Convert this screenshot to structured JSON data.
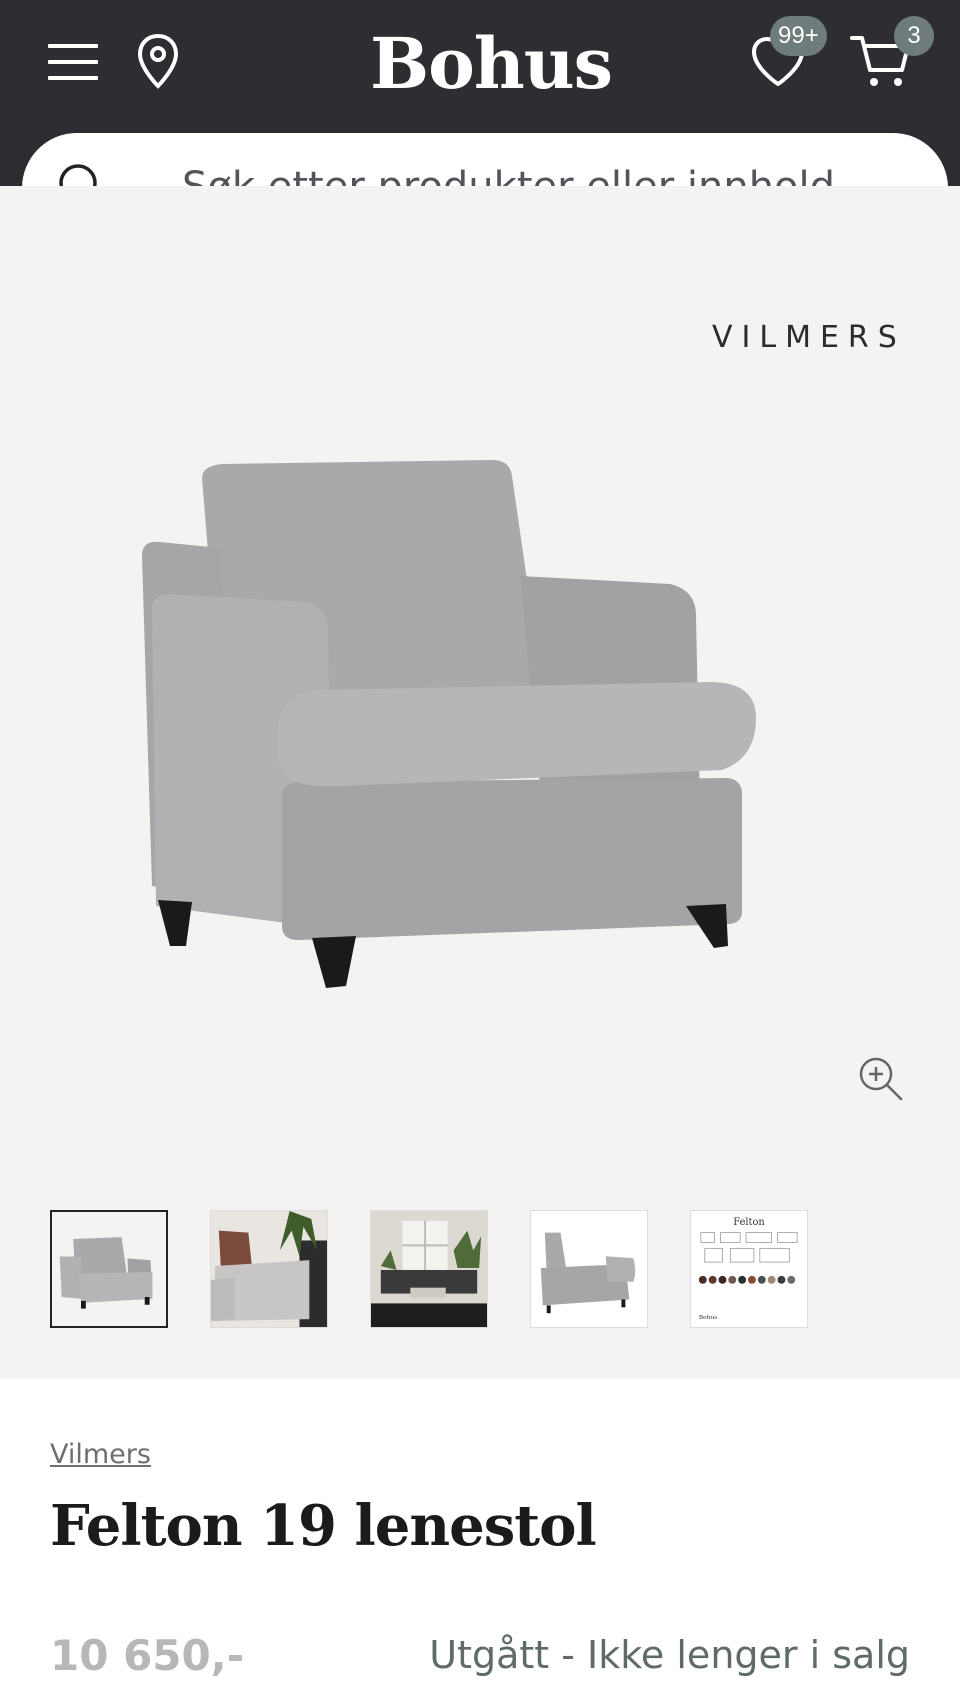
{
  "header": {
    "logo": "Bohus",
    "wishlist_count": "99+",
    "cart_count": "3",
    "icons": [
      "menu-icon",
      "location-pin-icon",
      "heart-icon",
      "cart-icon"
    ]
  },
  "search": {
    "placeholder": "Søk etter produkter eller innhold..."
  },
  "gallery": {
    "brand_logo": "VILMERS",
    "thumbnail_count": 5,
    "active_thumbnail": 1,
    "thumb5_title": "Felton",
    "thumb5_footer": "Bohus"
  },
  "product": {
    "brand": "Vilmers",
    "title": "Felton 19 lenestol",
    "price": "10 650,-",
    "status": "Utgått - Ikke lenger i salg"
  },
  "colors": {
    "header_bg": "#2e2d32",
    "badge": "#6e7c7b",
    "gallery_bg": "#f5f3f1",
    "price": "#b7b7b7",
    "status": "#5f6b6b"
  }
}
